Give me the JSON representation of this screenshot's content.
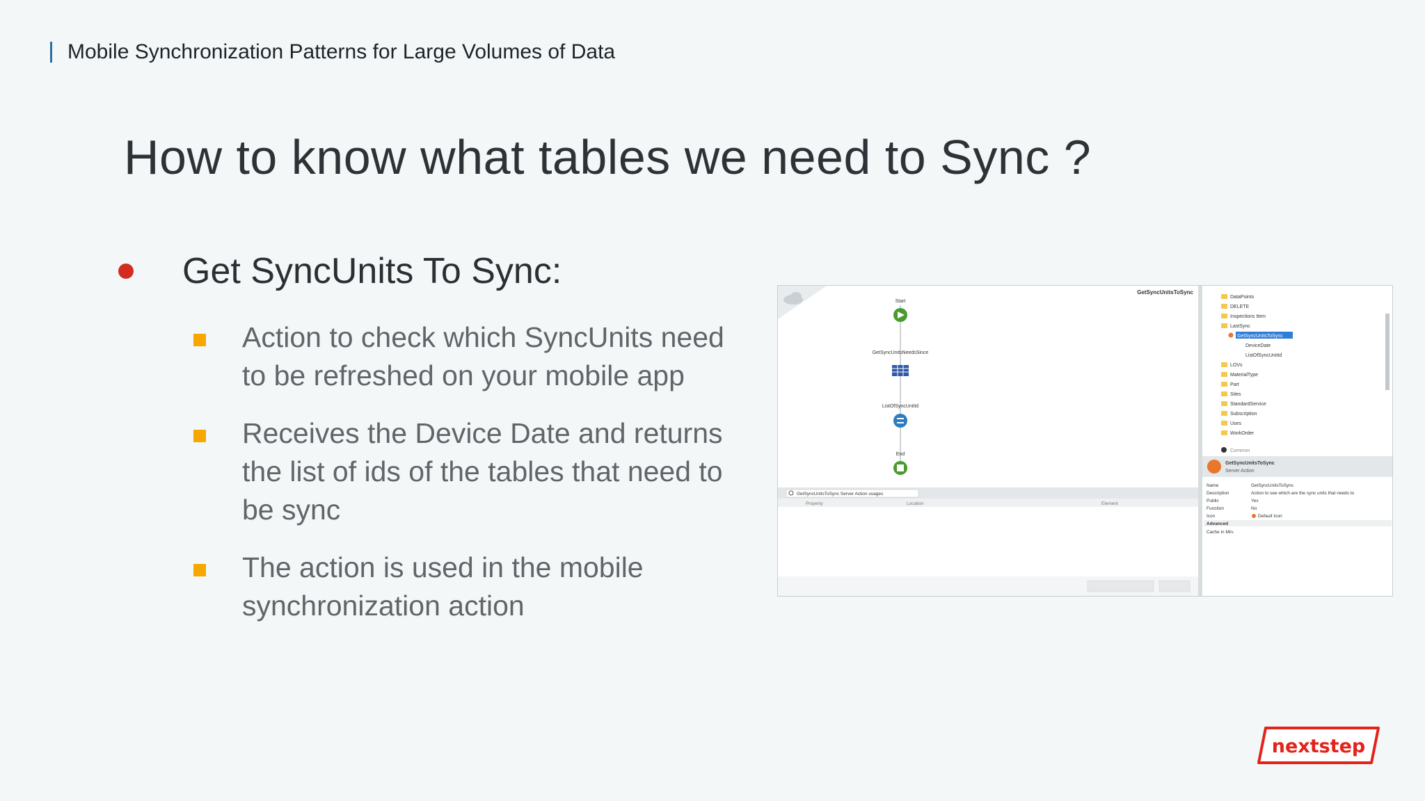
{
  "header": {
    "text": "Mobile Synchronization Patterns for Large Volumes of Data"
  },
  "slide": {
    "title": "How to know what tables we need to Sync ?",
    "main_bullet": "Get SyncUnits To Sync:",
    "sub_bullets": [
      {
        "text": "Action to check which SyncUnits need to  be refreshed on your mobile app"
      },
      {
        "text": "Receives the Device Date and returns the list of ids of the tables that need to be sync"
      },
      {
        "text": "The action is used in the mobile synchronization action"
      }
    ]
  },
  "screenshot": {
    "action_title": "GetSyncUnitsToSync",
    "flow_nodes": [
      "Start",
      "GetSyncUnitsNeedsSince",
      "ListOfSyncUnitId",
      "End"
    ],
    "tree_items": [
      "DataPoints",
      "DELETE",
      "Inspections Item",
      "LastSync",
      "GetSyncUnitsToSync",
      "DeviceDate",
      "ListOfSyncUnitId",
      "LOVs",
      "MaterialType",
      "Part",
      "Sites",
      "StandardService",
      "Subscription",
      "Uses",
      "WorkOrder",
      "Common"
    ],
    "properties_header": {
      "name": "GetSyncUnitsToSync",
      "type": "Server Action"
    },
    "properties": [
      {
        "label": "Name",
        "value": "GetSyncUnitsToSync"
      },
      {
        "label": "Description",
        "value": "Action to see which are the sync units that needs to"
      },
      {
        "label": "Public",
        "value": "Yes"
      },
      {
        "label": "Function",
        "value": "No"
      },
      {
        "label": "Icon",
        "value": "Default Icon"
      },
      {
        "label": "Advanced",
        "value": ""
      },
      {
        "label": "Cache in Min.",
        "value": ""
      }
    ],
    "usages_search": "GetSyncUnitsToSync Server Action usages",
    "usages_columns": [
      "Property",
      "Location",
      "Element"
    ]
  },
  "logo": {
    "text": "nextstep"
  },
  "colors": {
    "bullet_dot": "#d22b1f",
    "sub_mark": "#f6a800",
    "logo_red": "#e2231a",
    "header_bar": "#2c6f9e"
  }
}
